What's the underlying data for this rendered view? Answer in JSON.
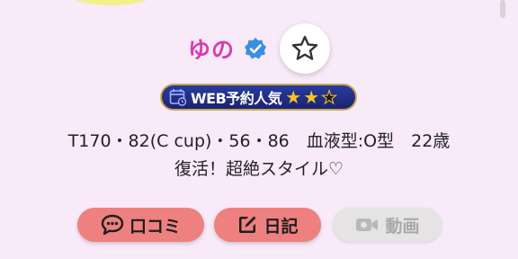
{
  "profile": {
    "name": "ゆの",
    "badge_text": "WEB予約人気",
    "badge_rating": 2,
    "badge_rating_max": 3,
    "stats": "T170・82(C cup)・56・86　血液型:O型　22歳",
    "catchphrase": "復活！超絶スタイル♡"
  },
  "icons": {
    "verified": "verified-check-icon",
    "favorite": "star-outline-icon",
    "calendar": "calendar-clock-icon",
    "reviews": "speech-bubble-icon",
    "diary": "edit-icon",
    "video": "video-camera-icon"
  },
  "actions": {
    "reviews_label": "口コミ",
    "diary_label": "日記",
    "video_label": "動画"
  },
  "colors": {
    "name": "#d93bb2",
    "action_active": "#ee8080",
    "action_disabled": "#e6e3e4",
    "badge_bg": "#1c2470",
    "star": "#f6c22b"
  }
}
